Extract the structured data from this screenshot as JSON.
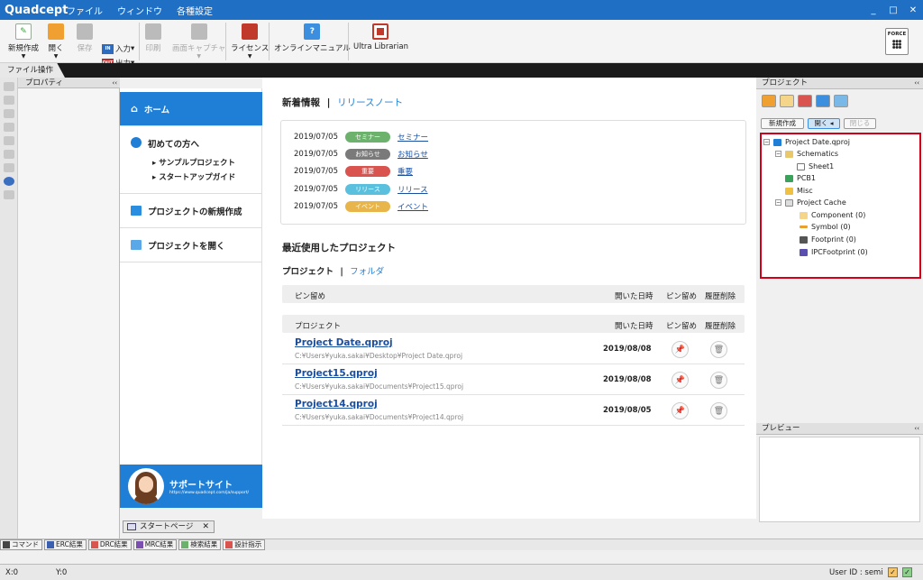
{
  "app": {
    "logo": "Quadcept",
    "menu": [
      "ファイル",
      "ウィンドウ",
      "各種設定"
    ],
    "controls": {
      "minimize": "_",
      "maximize": "□",
      "close": "✕"
    }
  },
  "ribbon": {
    "new": "新規作成",
    "open": "開く",
    "save": "保存",
    "input": "入力",
    "output": "出力",
    "input_icon_text": "IN",
    "output_icon_text": "OUT",
    "print": "印刷",
    "capture": "画面キャプチャ",
    "license": "ライセンス",
    "manual": "オンラインマニュアル",
    "ultra": "Ultra Librarian",
    "force": "FORCE",
    "group_tab": "ファイル操作"
  },
  "properties": {
    "title": "プロパティ",
    "collapse": "‹‹"
  },
  "home_nav": {
    "home": "ホーム",
    "beginners": "初めての方へ",
    "sample": "サンプルプロジェクト",
    "startup": "スタートアップガイド",
    "new_project": "プロジェクトの新規作成",
    "open_project": "プロジェクトを開く",
    "support_title": "サポートサイト",
    "support_url": "https://www.quadcept.com/ja/support/"
  },
  "start_tab": {
    "label": "スタートページ",
    "close": "✕"
  },
  "news": {
    "title": "新着情報",
    "separator": "|",
    "release_link": "リリースノート",
    "items": [
      {
        "date": "2019/07/05",
        "badge": "セミナー",
        "color": "#6cb26c",
        "link": "セミナー"
      },
      {
        "date": "2019/07/05",
        "badge": "お知らせ",
        "color": "#7a7a7a",
        "link": "お知らせ"
      },
      {
        "date": "2019/07/05",
        "badge": "重要",
        "color": "#d9534f",
        "link": "重要"
      },
      {
        "date": "2019/07/05",
        "badge": "リリース",
        "color": "#5bc0de",
        "link": "リリース"
      },
      {
        "date": "2019/07/05",
        "badge": "イベント",
        "color": "#e8b54a",
        "link": "イベント"
      }
    ]
  },
  "recent": {
    "title": "最近使用したプロジェクト",
    "tab_project": "プロジェクト",
    "separator": "|",
    "tab_folder": "フォルダ",
    "pinned_header": {
      "name": "ピン留め",
      "opened": "開いた日時",
      "pin": "ピン留め",
      "delete": "履歴削除"
    },
    "project_header": {
      "name": "プロジェクト",
      "opened": "開いた日時",
      "pin": "ピン留め",
      "delete": "履歴削除"
    },
    "projects": [
      {
        "name": "Project Date.qproj",
        "path": "C:¥Users¥yuka.sakai¥Desktop¥Project Date.qproj",
        "date": "2019/08/08"
      },
      {
        "name": "Project15.qproj",
        "path": "C:¥Users¥yuka.sakai¥Documents¥Project15.qproj",
        "date": "2019/08/08"
      },
      {
        "name": "Project14.qproj",
        "path": "C:¥Users¥yuka.sakai¥Documents¥Project14.qproj",
        "date": "2019/08/05"
      }
    ],
    "pin_icon": "📌",
    "trash_icon": "🗑"
  },
  "project_panel": {
    "title": "プロジェクト",
    "collapse": "‹‹",
    "buttons": {
      "new": "新規作成",
      "open": "開く",
      "close": "閉じる"
    },
    "tree": {
      "expand": "−",
      "root": "Project Date.qproj",
      "schematics": "Schematics",
      "sheet": "Sheet1",
      "pcb": "PCB1",
      "misc": "Misc",
      "cache": "Project Cache",
      "component": "Component (0)",
      "symbol": "Symbol (0)",
      "footprint": "Footprint (0)",
      "ipc": "IPCFootprint (0)"
    }
  },
  "preview": {
    "title": "プレビュー",
    "collapse": "‹‹"
  },
  "result_tabs": [
    "コマンド",
    "ERC結果",
    "DRC結果",
    "MRC結果",
    "検索結果",
    "設計指示"
  ],
  "result_tab_colors": [
    "#444444",
    "#3a5fb0",
    "#d9534f",
    "#7b4fb0",
    "#6cb26c",
    "#d9534f"
  ],
  "status": {
    "x": "X:0",
    "y": "Y:0",
    "user": "User ID : semi",
    "check": "✓"
  }
}
